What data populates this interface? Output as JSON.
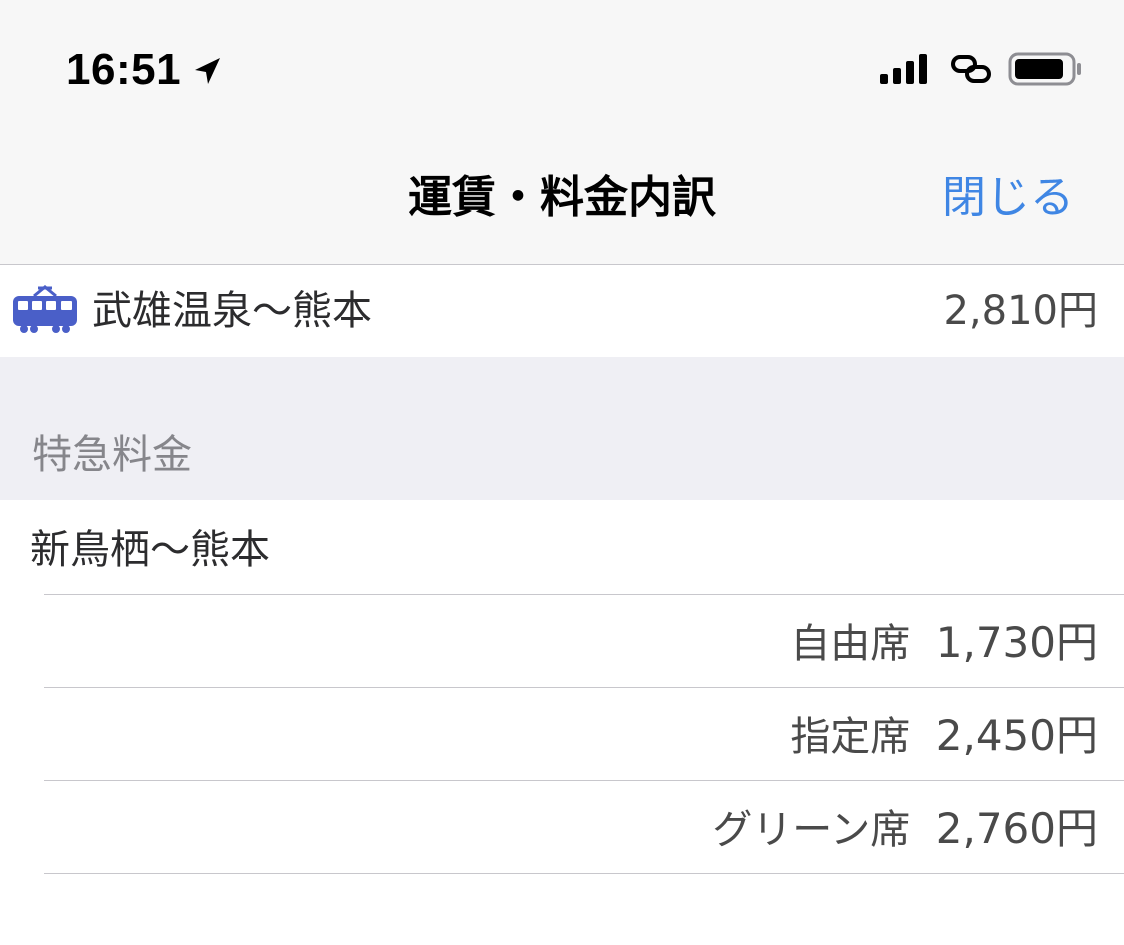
{
  "status_bar": {
    "time": "16:51",
    "icons": [
      "location-arrow-icon",
      "signal-bars-icon",
      "personal-hotspot-icon",
      "battery-icon"
    ]
  },
  "nav": {
    "title": "運賃・料金内訳",
    "close_label": "閉じる"
  },
  "fare": {
    "icon": "train-icon",
    "route": "武雄温泉〜熊本",
    "price": "2,810円"
  },
  "express": {
    "header": "特急料金",
    "route": "新鳥栖〜熊本",
    "seats": [
      {
        "label": "自由席",
        "price": "1,730円"
      },
      {
        "label": "指定席",
        "price": "2,450円"
      },
      {
        "label": "グリーン席",
        "price": "2,760円"
      }
    ]
  },
  "colors": {
    "accent": "#3f86e4",
    "train_icon": "#4a5fc8",
    "nav_bg": "#f7f7f7",
    "section_bg": "#efeff4"
  }
}
